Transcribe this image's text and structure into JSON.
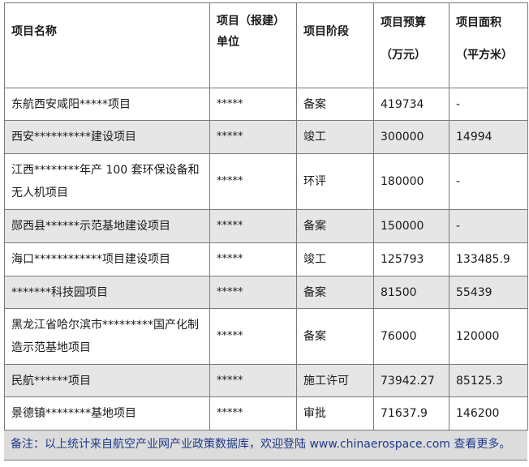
{
  "headers": {
    "name": "项目名称",
    "unit_line1": "项目（报建）",
    "unit_line2": "单位",
    "stage": "项目阶段",
    "budget_line1": "项目预算",
    "budget_line2": "（万元）",
    "area_line1": "项目面积",
    "area_line2": "（平方米）"
  },
  "rows": [
    {
      "name": "东航西安咸阳*****项目",
      "unit": "*****",
      "stage": "备案",
      "budget": "419734",
      "area": "-"
    },
    {
      "name": "西安**********建设项目",
      "unit": "*****",
      "stage": "竣工",
      "budget": "300000",
      "area": "14994"
    },
    {
      "name": "江西********年产 100 套环保设备和无人机项目",
      "unit": "*****",
      "stage": "环评",
      "budget": "180000",
      "area": "-"
    },
    {
      "name": "郧西县******示范基地建设项目",
      "unit": "*****",
      "stage": "备案",
      "budget": "150000",
      "area": "-"
    },
    {
      "name": "海口************项目建设项目",
      "unit": "*****",
      "stage": "竣工",
      "budget": "125793",
      "area": "133485.9"
    },
    {
      "name": "*******科技园项目",
      "unit": "*****",
      "stage": "备案",
      "budget": "81500",
      "area": "55439"
    },
    {
      "name": "黑龙江省哈尔滨市*********国产化制造示范基地项目",
      "unit": "*****",
      "stage": "备案",
      "budget": "76000",
      "area": "120000"
    },
    {
      "name": "民航******项目",
      "unit": "*****",
      "stage": "施工许可",
      "budget": "73942.27",
      "area": "85125.3"
    },
    {
      "name": "景德镇********基地项目",
      "unit": "*****",
      "stage": "审批",
      "budget": "71637.9",
      "area": "146200"
    }
  ],
  "note": "备注：以上统计来自航空产业网产业政策数据库，欢迎登陆 www.chinaerospace.com 查看更多。"
}
